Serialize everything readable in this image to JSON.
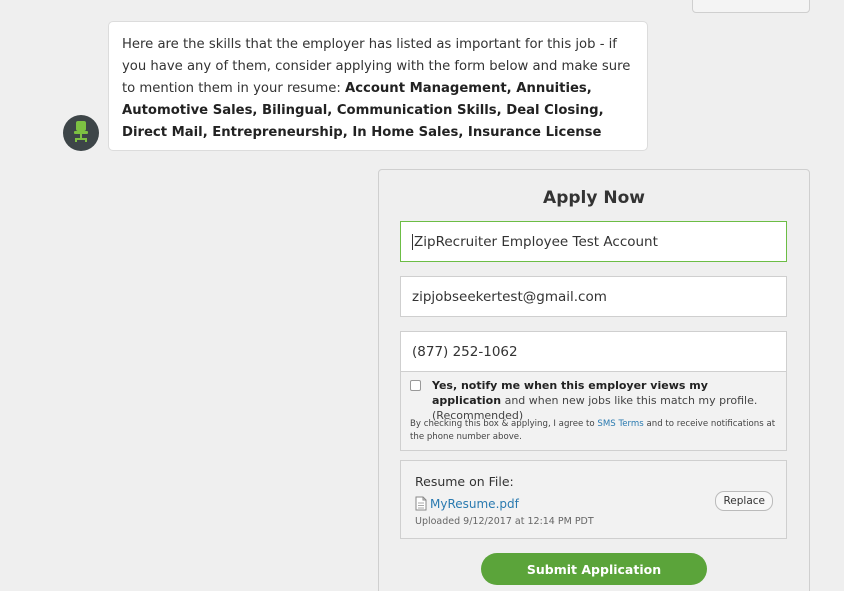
{
  "chat": {
    "message_intro": "Here are the skills that the employer has listed as important for this job - if you have any of them, consider applying with the form below and make sure to mention them in your resume: ",
    "skills": "Account Management, Annuities, Automotive Sales, Bilingual, Communication Skills, Deal Closing, Direct Mail, Entrepreneurship, In Home Sales, Insurance License",
    "avatar_icon": "office-chair-icon"
  },
  "apply": {
    "title": "Apply Now",
    "name_value": "ZipRecruiter Employee Test Account",
    "email_value": "zipjobseekertest@gmail.com",
    "phone_value": "(877) 252-1062",
    "sms_bold": "Yes, notify me when this employer views my application",
    "sms_rest": " and when new jobs like this match my profile. (Recommended)",
    "terms_prefix": "By checking this box & applying, I agree to ",
    "terms_link": "SMS Terms",
    "terms_suffix": " and to receive notifications at the phone number above.",
    "resume_label": "Resume on File:",
    "resume_file": "MyResume.pdf",
    "resume_date": "Uploaded 9/12/2017 at 12:14 PM PDT",
    "replace_label": "Replace",
    "submit_label": "Submit Application"
  },
  "colors": {
    "accent_green": "#5ba43a",
    "link_blue": "#2a7ab0",
    "avatar_bg": "#3d4548"
  }
}
